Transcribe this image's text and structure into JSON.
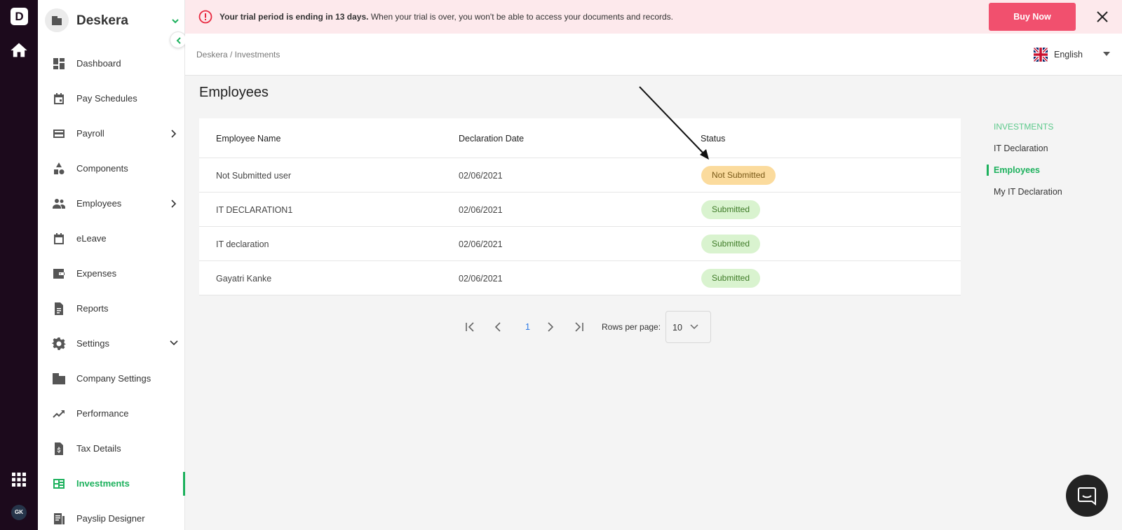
{
  "rail": {
    "logo_letter": "D",
    "user_initials": "GK"
  },
  "sidebar": {
    "org_name": "Deskera",
    "items": [
      {
        "label": "Dashboard",
        "icon": "dashboard-icon"
      },
      {
        "label": "Pay Schedules",
        "icon": "calendar-icon"
      },
      {
        "label": "Payroll",
        "icon": "card-icon"
      },
      {
        "label": "Components",
        "icon": "shapes-icon"
      },
      {
        "label": "Employees",
        "icon": "people-icon"
      },
      {
        "label": "eLeave",
        "icon": "calendar-icon"
      },
      {
        "label": "Expenses",
        "icon": "wallet-icon"
      },
      {
        "label": "Reports",
        "icon": "document-icon"
      },
      {
        "label": "Settings",
        "icon": "gear-icon"
      },
      {
        "label": "Company Settings",
        "icon": "building-icon"
      },
      {
        "label": "Performance",
        "icon": "trending-icon"
      },
      {
        "label": "Tax Details",
        "icon": "tax-icon"
      },
      {
        "label": "Investments",
        "icon": "investments-icon"
      },
      {
        "label": "Payslip Designer",
        "icon": "payslip-icon"
      }
    ],
    "active_item": "Investments"
  },
  "banner": {
    "message_bold": "Your trial period is ending in 13 days.",
    "message_rest": " When your trial is over, you won't be able to access your documents and records.",
    "buy_label": "Buy Now"
  },
  "header": {
    "breadcrumb": "Deskera / Investments",
    "language": "English"
  },
  "main": {
    "title": "Employees",
    "columns": [
      "Employee Name",
      "Declaration Date",
      "Status"
    ],
    "rows": [
      {
        "name": "Not Submitted user",
        "date": "02/06/2021",
        "status": "Not Submitted"
      },
      {
        "name": "IT DECLARATION1",
        "date": "02/06/2021",
        "status": "Submitted"
      },
      {
        "name": "IT declaration",
        "date": "02/06/2021",
        "status": "Submitted"
      },
      {
        "name": "Gayatri Kanke",
        "date": "02/06/2021",
        "status": "Submitted"
      }
    ],
    "pagination": {
      "current_page": "1",
      "rows_per_page_label": "Rows per page:",
      "rows_per_page": "10"
    }
  },
  "subnav": {
    "heading": "INVESTMENTS",
    "items": [
      "IT Declaration",
      "Employees",
      "My IT Declaration"
    ],
    "active": "Employees"
  },
  "colors": {
    "accent_green": "#1db15d",
    "rail_bg": "#1c0a1c",
    "buy_button": "#f1506e",
    "banner_bg": "#fde9ec",
    "badge_not_submitted": "#fbdb9d",
    "badge_submitted": "#d9f3cf"
  }
}
